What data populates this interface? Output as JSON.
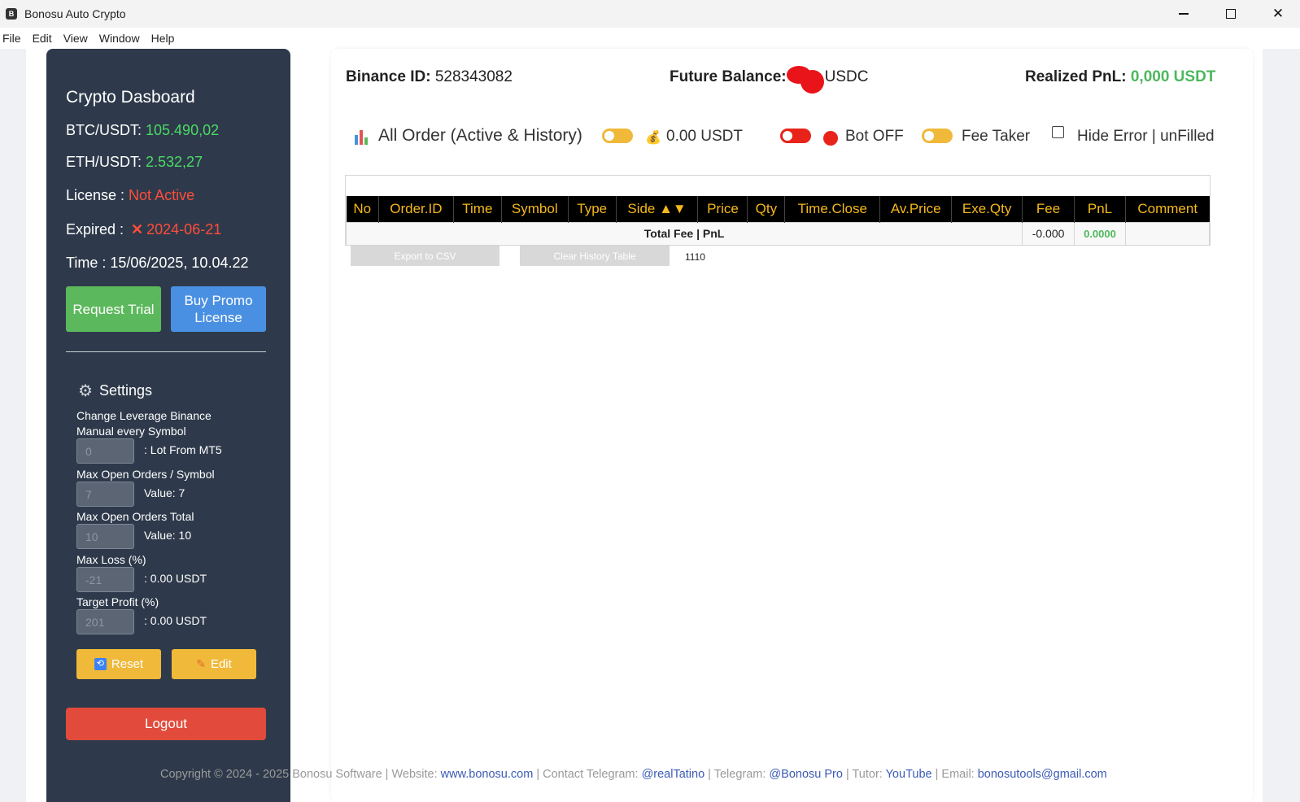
{
  "window": {
    "title": "Bonosu Auto Crypto",
    "minimize": "—",
    "close": "✕"
  },
  "menu": [
    "File",
    "Edit",
    "View",
    "Window",
    "Help"
  ],
  "sidebar": {
    "title": "Crypto Dasboard",
    "btc_label": "BTC/USDT: ",
    "btc_value": "105.490,02",
    "eth_label": "ETH/USDT: ",
    "eth_value": "2.532,27",
    "license_label": "License : ",
    "license_value": "Not Active",
    "expired_label": "Expired : ",
    "expired_value": "2024-06-21",
    "time_text": "Time : 15/06/2025, 10.04.22",
    "request_trial": "Request Trial",
    "buy_promo": "Buy Promo License",
    "settings_title": "Settings",
    "settings": {
      "leverage_label": "Change Leverage Binance Manual every Symbol",
      "lot_value": "0",
      "lot_suffix": ": Lot From MT5",
      "max_open_symbol_label": "Max Open Orders / Symbol",
      "max_open_symbol_value": "7",
      "max_open_symbol_suffix": "Value: 7",
      "max_open_total_label": "Max Open Orders Total",
      "max_open_total_value": "10",
      "max_open_total_suffix": "Value: 10",
      "max_loss_label": "Max Loss (%)",
      "max_loss_value": "-21",
      "max_loss_suffix": ": 0.00 USDT",
      "target_profit_label": "Target Profit (%)",
      "target_profit_value": "201",
      "target_profit_suffix": ": 0.00 USDT"
    },
    "reset_label": "Reset",
    "edit_label": "Edit",
    "logout_label": "Logout"
  },
  "header": {
    "binance_id_label": "Binance ID:",
    "binance_id_value": "528343082",
    "future_balance_label": "Future Balance:",
    "future_balance_unit": "USDC",
    "realized_pnl_label": "Realized PnL:",
    "realized_pnl_value": "0,000 USDT"
  },
  "toolbar": {
    "title": "All Order (Active & History)",
    "amount": "0.00 USDT",
    "bot_status": "Bot OFF",
    "fee_taker": "Fee Taker",
    "hide_error": "Hide Error | unFilled"
  },
  "table": {
    "columns": [
      "No",
      "Order.ID",
      "Time",
      "Symbol",
      "Type",
      "Side ▲▼",
      "Price",
      "Qty",
      "Time.Close",
      "Av.Price",
      "Exe.Qty",
      "Fee",
      "PnL",
      "Comment"
    ],
    "total_label": "Total Fee | PnL",
    "total_fee": "-0.000",
    "total_pnl": "0.0000"
  },
  "actions": {
    "export_csv": "Export to CSV",
    "clear_history": "Clear History Table",
    "count": "1110"
  },
  "footer": {
    "prefix": "Copyright © 2024 - 2025 Bonosu Software | Website: ",
    "website": "www.bonosu.com",
    "contact_label": " | Contact Telegram: ",
    "contact": "@realTatino",
    "telegram_label": " | Telegram: ",
    "telegram": "@Bonosu Pro",
    "tutor_label": " | Tutor: ",
    "tutor": "YouTube",
    "email_label": " | Email: ",
    "email": "bonosutools@gmail.com"
  },
  "colors": {
    "sidebar_bg": "#2e3a4b",
    "accent_green": "#4cd964",
    "accent_red": "#ff4d3a",
    "table_header_text": "#f5b81b"
  }
}
